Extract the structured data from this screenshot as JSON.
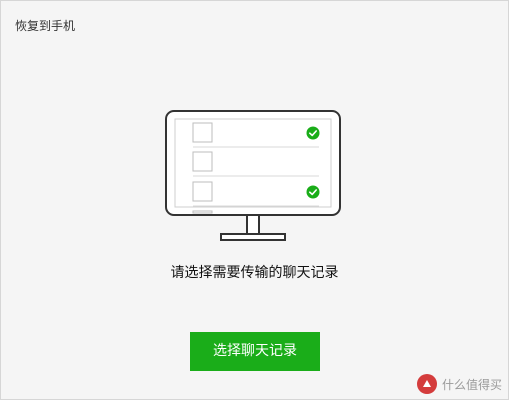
{
  "window": {
    "title": "恢复到手机"
  },
  "main": {
    "prompt": "请选择需要传输的聊天记录",
    "select_button_label": "选择聊天记录"
  },
  "illustration": {
    "rows": [
      {
        "checked": true
      },
      {
        "checked": false
      },
      {
        "checked": true
      }
    ]
  },
  "watermark": {
    "text": "什么值得买"
  },
  "colors": {
    "accent": "#1aad19",
    "background": "#f5f5f5",
    "monitor_stroke": "#333333"
  }
}
